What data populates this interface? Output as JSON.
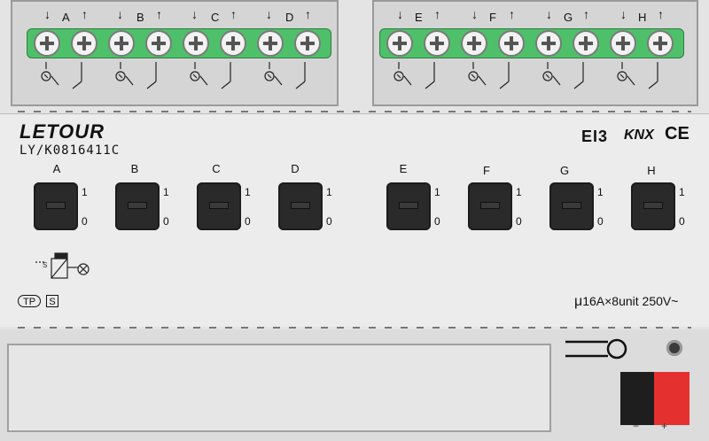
{
  "device": {
    "brand": "LETOUR",
    "model": "LY/K0816411C",
    "certifications": [
      "EI3",
      "KNX",
      "CE"
    ],
    "rating": "16A×8unit 250V~",
    "rating_prefix": "μ",
    "badges": [
      "TP",
      "S"
    ],
    "bus_terminal": {
      "neg_label": "−",
      "pos_label": "+"
    }
  },
  "channels": [
    "A",
    "B",
    "C",
    "D",
    "E",
    "F",
    "G",
    "H"
  ],
  "switch_positions": {
    "on": "1",
    "off": "0"
  },
  "terminal_arrows": {
    "in": "↓",
    "out": "↑"
  },
  "colors": {
    "terminal_green": "#4fc06a",
    "bus_red": "#e53030",
    "switch_black": "#2a2a2a"
  }
}
